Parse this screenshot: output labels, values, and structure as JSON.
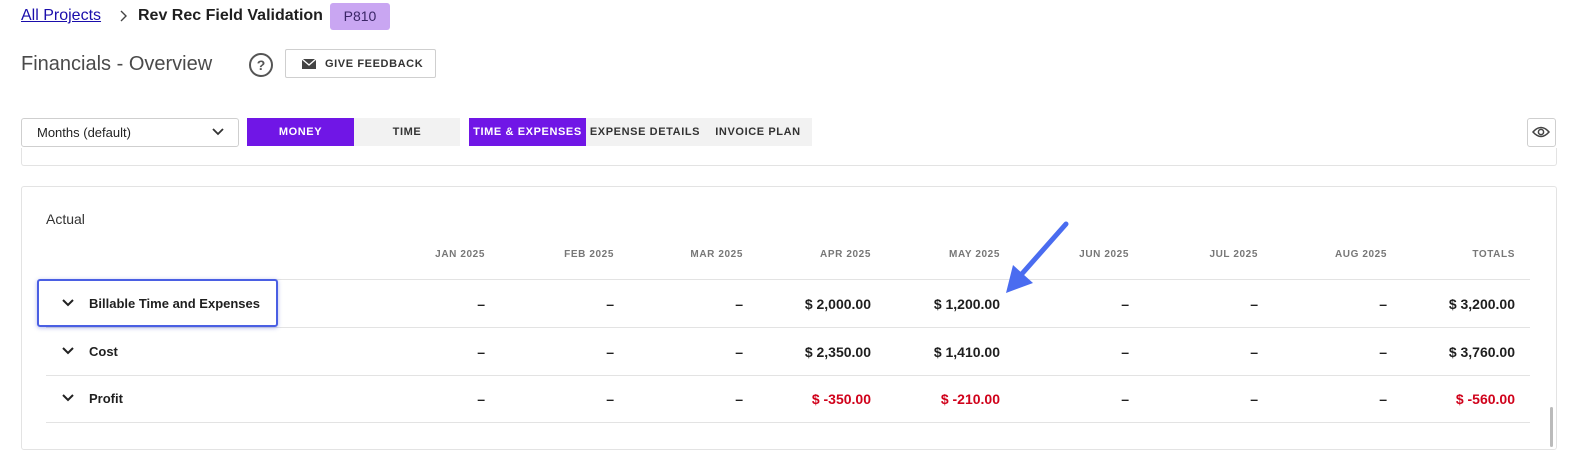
{
  "breadcrumb": {
    "root_label": "All Projects",
    "current_label": "Rev Rec Field Validation",
    "project_id": "P810"
  },
  "header": {
    "title": "Financials - Overview",
    "help_label": "?",
    "feedback_label": "GIVE FEEDBACK"
  },
  "controls": {
    "period_select": "Months (default)",
    "tabs": [
      {
        "label": "MONEY",
        "active": true
      },
      {
        "label": "TIME",
        "active": false
      },
      {
        "label": "TIME & EXPENSES",
        "active": true
      },
      {
        "label": "EXPENSE DETAILS",
        "active": false
      },
      {
        "label": "INVOICE PLAN",
        "active": false
      }
    ]
  },
  "table": {
    "section_title": "Actual",
    "columns": [
      "JAN 2025",
      "FEB 2025",
      "MAR 2025",
      "APR 2025",
      "MAY 2025",
      "JUN 2025",
      "JUL 2025",
      "AUG 2025",
      "TOTALS"
    ],
    "rows": [
      {
        "label": "Billable Time and Expenses",
        "values": [
          "–",
          "–",
          "–",
          "$ 2,000.00",
          "$ 1,200.00",
          "–",
          "–",
          "–",
          "$ 3,200.00"
        ]
      },
      {
        "label": "Cost",
        "values": [
          "–",
          "–",
          "–",
          "$ 2,350.00",
          "$ 1,410.00",
          "–",
          "–",
          "–",
          "$ 3,760.00"
        ]
      },
      {
        "label": "Profit",
        "values": [
          "–",
          "–",
          "–",
          "$ -350.00",
          "$ -210.00",
          "–",
          "–",
          "–",
          "$ -560.00"
        ]
      }
    ]
  },
  "colors": {
    "accent": "#7016e6",
    "badge": "#c9a6f2",
    "negative": "#d0021b",
    "annotation": "#4a5fe3"
  }
}
